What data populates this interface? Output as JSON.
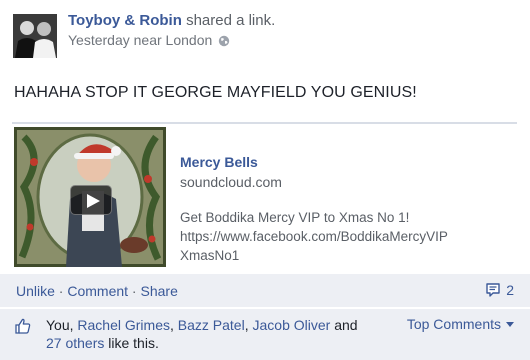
{
  "post": {
    "author": "Toyboy & Robin",
    "action": "shared a link.",
    "time": "Yesterday near London",
    "privacy_icon": "globe-icon",
    "status": "HAHAHA STOP IT GEORGE MAYFIELD YOU GENIUS!"
  },
  "share": {
    "title": "Mercy Bells",
    "domain": "soundcloud.com",
    "desc_line1": "Get Boddika Mercy VIP to Xmas No 1!",
    "desc_line2": "https://www.facebook.com/BoddikaMercyVIP",
    "desc_line3": "XmasNo1",
    "thumb_overlay_icon": "play-icon"
  },
  "actions": {
    "unlike": "Unlike",
    "comment": "Comment",
    "share": "Share",
    "separator": " · ",
    "comment_count": "2",
    "comment_icon": "comment-icon"
  },
  "likes": {
    "you": "You,",
    "person1": "Rachel Grimes",
    "person2": "Bazz Patel",
    "person3": "Jacob Oliver",
    "and_text": "and",
    "others": "27 others",
    "suffix": "like this.",
    "top_comments": "Top Comments",
    "like_icon": "thumbs-up-icon"
  },
  "colors": {
    "link": "#3b5998",
    "bar_bg": "#edeff4",
    "text": "#1d2129",
    "muted": "#5a5f66"
  }
}
